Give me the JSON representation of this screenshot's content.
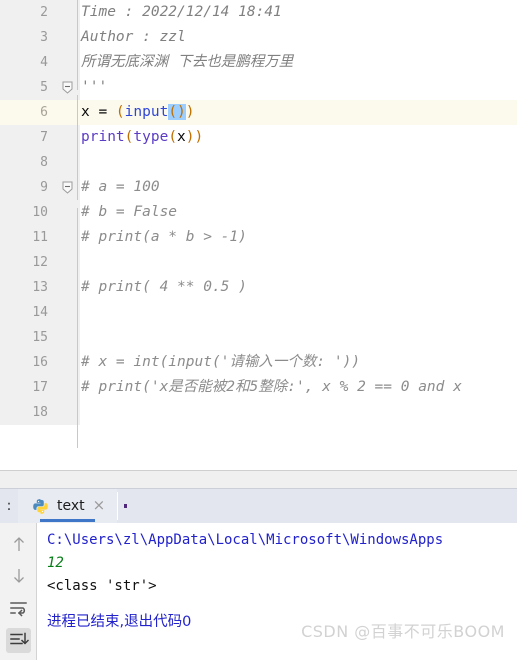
{
  "editor": {
    "first_visible_line": 2,
    "current_line": 6,
    "lines": [
      {
        "num": 2,
        "kind": "doc",
        "text": "Time : 2022/12/14 18:41"
      },
      {
        "num": 3,
        "kind": "doc",
        "text": "Author : zzl"
      },
      {
        "num": 4,
        "kind": "doc_cn",
        "text": "所谓无底深渊  下去也是鹏程万里"
      },
      {
        "num": 5,
        "kind": "doc",
        "text": "'''",
        "fold": "collapse",
        "squiggle": true
      },
      {
        "num": 6,
        "kind": "code6",
        "text": "x = (input())",
        "current": true
      },
      {
        "num": 7,
        "kind": "code7",
        "text": "print(type(x))"
      },
      {
        "num": 8,
        "kind": "empty",
        "text": ""
      },
      {
        "num": 9,
        "kind": "comment",
        "text": "# a = 100",
        "fold": "collapse"
      },
      {
        "num": 10,
        "kind": "comment",
        "text": "# b = False"
      },
      {
        "num": 11,
        "kind": "comment",
        "text": "# print(a * b > -1)"
      },
      {
        "num": 12,
        "kind": "empty",
        "text": ""
      },
      {
        "num": 13,
        "kind": "comment",
        "text": "# print( 4 ** 0.5 )"
      },
      {
        "num": 14,
        "kind": "empty",
        "text": ""
      },
      {
        "num": 15,
        "kind": "empty",
        "text": ""
      },
      {
        "num": 16,
        "kind": "comment_cn",
        "text": "# x = int(input('请输入一个数: '))"
      },
      {
        "num": 17,
        "kind": "comment_cn",
        "text": "# print('x是否能被2和5整除:', x % 2 == 0 and x"
      },
      {
        "num": 18,
        "kind": "empty",
        "text": ""
      }
    ],
    "line6_parts": {
      "prefix": "x = ",
      "open_paren": "(",
      "builtin": "input",
      "selected": "()",
      "close_paren": ")"
    },
    "line7_parts": {
      "func1": "print",
      "p1": "(",
      "func2": "type",
      "p2": "(",
      "arg": "x",
      "p3": "))"
    }
  },
  "toolwindow": {
    "corner_label": ":",
    "tab": {
      "icon": "python-icon",
      "label": "text",
      "close": "×"
    }
  },
  "console": {
    "toolbar": [
      {
        "name": "up-arrow-icon",
        "label": "↑",
        "pressed": false
      },
      {
        "name": "down-arrow-icon",
        "label": "↓",
        "pressed": false
      },
      {
        "name": "soft-wrap-icon",
        "label": "wrap",
        "pressed": false
      },
      {
        "name": "scroll-to-end-icon",
        "label": "end",
        "pressed": true
      }
    ],
    "lines": [
      {
        "kind": "path",
        "text": "C:\\Users\\zl\\AppData\\Local\\Microsoft\\WindowsApps"
      },
      {
        "kind": "num",
        "text": "12"
      },
      {
        "kind": "out",
        "text": "<class 'str'>"
      },
      {
        "kind": "blank",
        "text": ""
      },
      {
        "kind": "exit",
        "text": "进程已结束,退出代码0"
      }
    ]
  },
  "watermark": {
    "text": "CSDN @百事不可乐BOOM"
  },
  "colors": {
    "current_line_bg": "#fcfaed",
    "gutter_bg": "#f0f0f0",
    "selection_bg": "#9cceff",
    "tab_accent": "#4076c8",
    "tabbar_bg": "#e3e5ef",
    "comment_fg": "#8c8c8c",
    "builtin_fg": "#2f46d6",
    "func_fg": "#5b3cc4",
    "paren_fg": "#c07000",
    "console_path_fg": "#2222cc",
    "console_num_fg": "#067d17"
  }
}
